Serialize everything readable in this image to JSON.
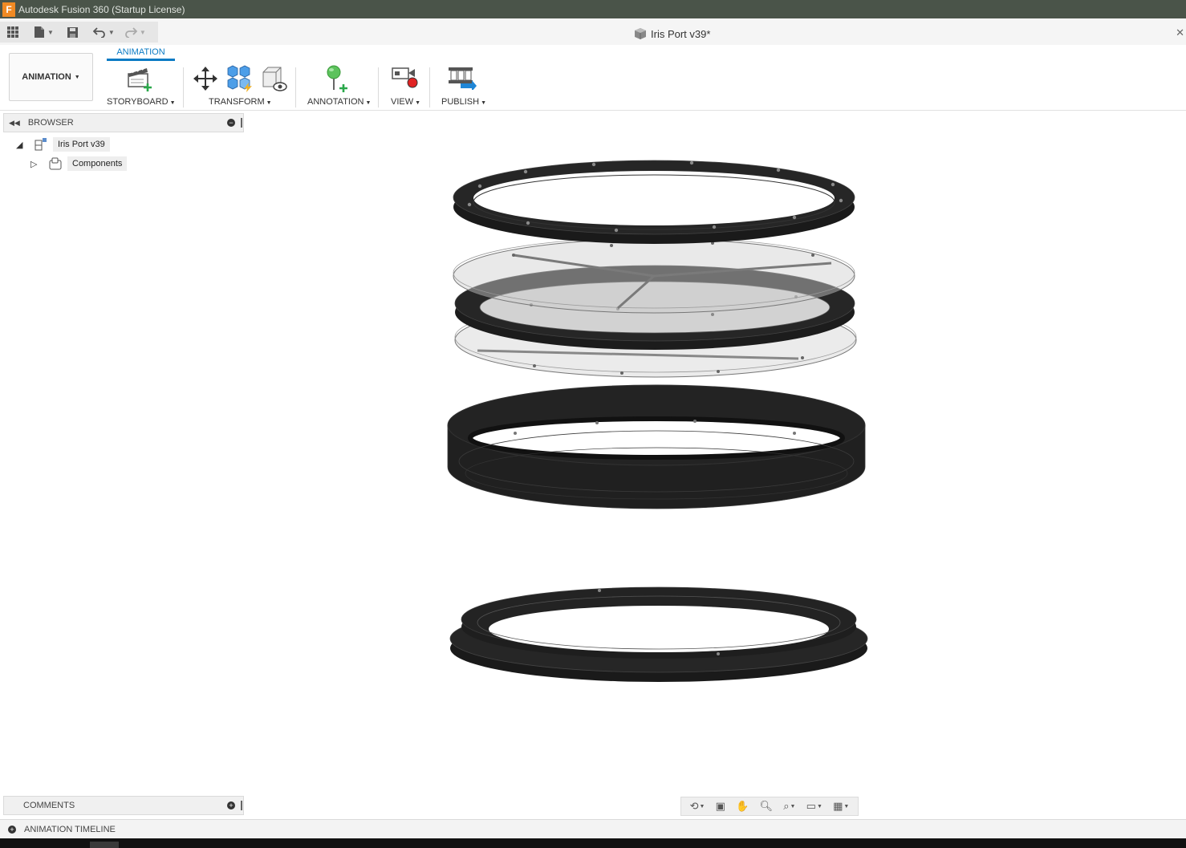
{
  "window": {
    "title": "Autodesk Fusion 360 (Startup License)",
    "logo_letter": "F"
  },
  "document": {
    "title": "Iris Port v39*"
  },
  "toolbar": {
    "workspace_label": "ANIMATION",
    "active_tab": "ANIMATION",
    "groups": {
      "storyboard": "STORYBOARD",
      "transform": "TRANSFORM",
      "annotation": "ANNOTATION",
      "view": "VIEW",
      "publish": "PUBLISH"
    }
  },
  "browser": {
    "header": "BROWSER",
    "root_item": "Iris Port v39",
    "child_item": "Components"
  },
  "comments": {
    "header": "COMMENTS"
  },
  "timeline": {
    "header": "ANIMATION TIMELINE"
  },
  "colors": {
    "titlebar": "#4a5449",
    "accent": "#0b7bc4",
    "model_dark": "#1c1c1c",
    "glass": "#cfcfcf"
  },
  "icons": {
    "app_menu": "grid-icon",
    "file": "file-icon",
    "save": "save-icon",
    "undo": "undo-icon",
    "redo": "redo-icon",
    "doc": "cube-icon"
  }
}
